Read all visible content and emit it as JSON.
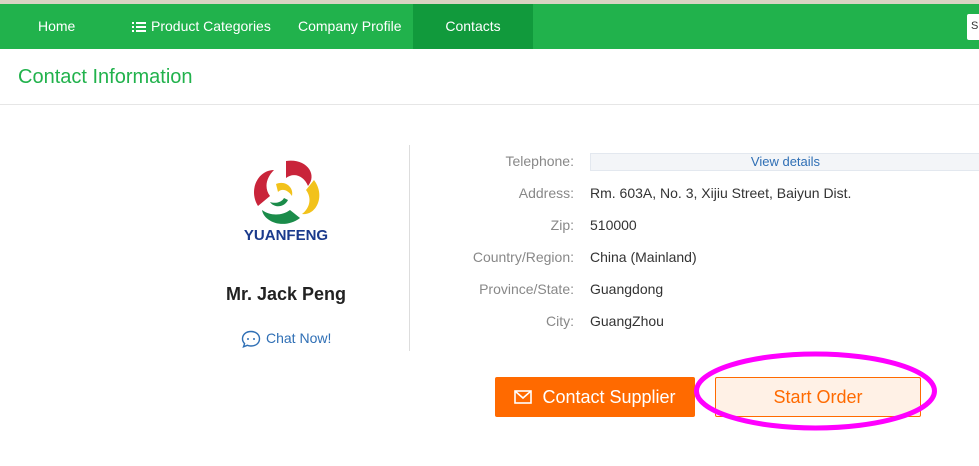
{
  "nav": {
    "items": [
      {
        "label": "Home"
      },
      {
        "label": "Product Categories",
        "icon": "list-icon"
      },
      {
        "label": "Company Profile"
      },
      {
        "label": "Contacts",
        "active": true
      }
    ],
    "right_stub": "S"
  },
  "section_title": "Contact Information",
  "company": {
    "logo_text": "YUANFENG",
    "person_name": "Mr. Jack Peng",
    "chat_label": "Chat Now!"
  },
  "contact": {
    "telephone": {
      "label": "Telephone:",
      "value": "View details"
    },
    "rows": [
      {
        "label": "Address:",
        "value": "Rm. 603A, No. 3, Xijiu Street, Baiyun Dist."
      },
      {
        "label": "Zip:",
        "value": "510000"
      },
      {
        "label": "Country/Region:",
        "value": "China (Mainland)"
      },
      {
        "label": "Province/State:",
        "value": "Guangdong"
      },
      {
        "label": "City:",
        "value": "GuangZhou"
      }
    ]
  },
  "buttons": {
    "contact_supplier": "Contact Supplier",
    "start_order": "Start Order"
  },
  "colors": {
    "nav_green": "#21b24c",
    "nav_active": "#119a3c",
    "title_green": "#21b24c",
    "orange": "#ff6a00",
    "highlight_magenta": "#ff00ff",
    "link_blue": "#2f6fb5"
  }
}
